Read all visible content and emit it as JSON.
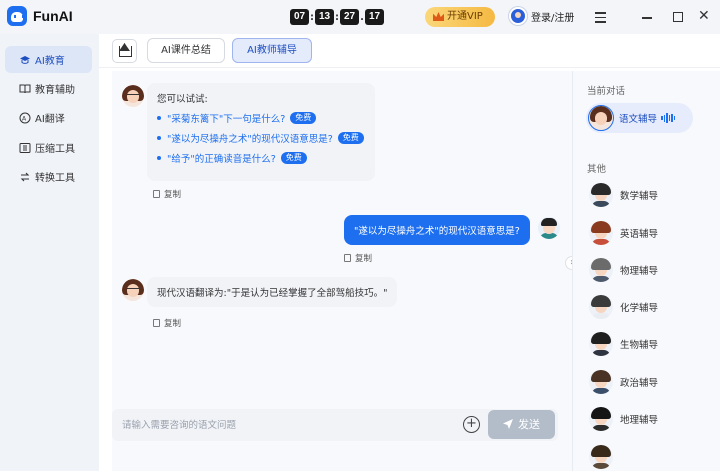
{
  "app": {
    "name": "FunAI"
  },
  "timer": [
    "07",
    "13",
    "27",
    "17"
  ],
  "header": {
    "vip_label": "开通VIP",
    "login_label": "登录/注册"
  },
  "sidebar": {
    "items": [
      {
        "label": "AI教育",
        "icon": "graduation-cap-icon",
        "active": true
      },
      {
        "label": "教育辅助",
        "icon": "book-icon",
        "active": false
      },
      {
        "label": "AI翻译",
        "icon": "translate-icon",
        "active": false
      },
      {
        "label": "压缩工具",
        "icon": "compress-icon",
        "active": false
      },
      {
        "label": "转换工具",
        "icon": "convert-icon",
        "active": false
      }
    ]
  },
  "tabs": [
    {
      "label": "AI课件总结",
      "active": false
    },
    {
      "label": "AI教师辅导",
      "active": true
    }
  ],
  "chat": {
    "intro": "您可以试试:",
    "suggestions": [
      {
        "text": "\"采菊东篱下\"下一句是什么?",
        "badge": "免费"
      },
      {
        "text": "\"遂以为尽操舟之术\"的现代汉语意思是?",
        "badge": "免费"
      },
      {
        "text": "\"给予\"的正确读音是什么?",
        "badge": "免费"
      }
    ],
    "copy_label": "复制",
    "user_message": "\"遂以为尽操舟之术\"的现代汉语意思是?",
    "bot_reply": "现代汉语翻译为:\"于是认为已经掌握了全部驾船技巧。\"",
    "input_placeholder": "请输入需要咨询的语文问题",
    "send_label": "发送"
  },
  "right_panel": {
    "current_heading": "当前对话",
    "current_item": "语文辅导",
    "other_heading": "其他",
    "others": [
      "数学辅导",
      "英语辅导",
      "物理辅导",
      "化学辅导",
      "生物辅导",
      "政治辅导",
      "地理辅导"
    ]
  },
  "colors": {
    "accent": "#1e6ff0",
    "send_disabled": "#b3bcc9",
    "vip_gold": "#f5b942"
  }
}
